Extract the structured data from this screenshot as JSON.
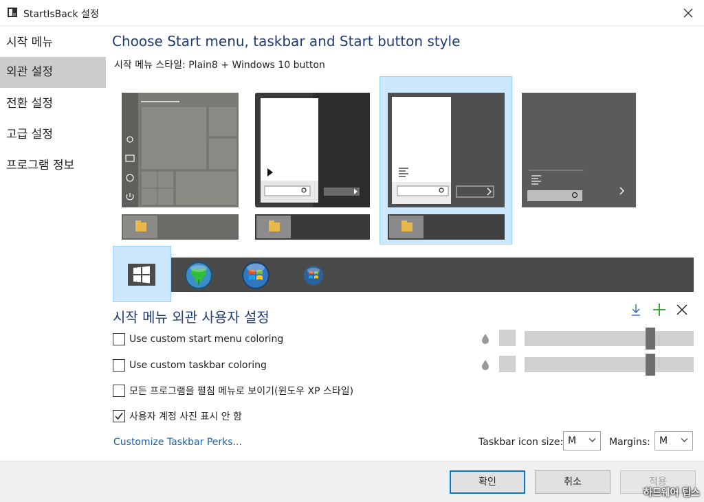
{
  "window": {
    "title": "StartIsBack 설정"
  },
  "sidebar": {
    "items": [
      {
        "label": "시작 메뉴",
        "active": false
      },
      {
        "label": "외관 설정",
        "active": true
      },
      {
        "label": "전환 설정",
        "active": false
      },
      {
        "label": "고급 설정",
        "active": false
      },
      {
        "label": "프로그램 정보",
        "active": false
      }
    ]
  },
  "main": {
    "heading": "Choose Start menu, taskbar and Start button style",
    "style_label": "시작 메뉴 스타일:",
    "style_value": "Plain8 + Windows 10 button"
  },
  "styles": [
    {
      "icon": "windows10-style-preview-icon",
      "selected": false
    },
    {
      "icon": "windows7-style-preview-icon",
      "selected": false
    },
    {
      "icon": "plain8-style-preview-icon",
      "selected": true
    },
    {
      "icon": "windows8-style-preview-icon",
      "selected": false
    }
  ],
  "start_buttons": [
    {
      "icon": "windows10-logo-icon",
      "selected": true
    },
    {
      "icon": "clover-orb-icon",
      "selected": false
    },
    {
      "icon": "windows7-orb-icon",
      "selected": false
    },
    {
      "icon": "windows-orb-small-icon",
      "selected": false
    }
  ],
  "customize": {
    "title": "시작 메뉴 외관 사용자 설정",
    "tools": [
      "download-icon",
      "add-icon",
      "close-icon"
    ],
    "options": [
      {
        "label": "Use custom start menu coloring",
        "checked": false
      },
      {
        "label": "Use custom taskbar coloring",
        "checked": false
      },
      {
        "label": "모든 프로그램을 펼침 메뉴로 보이기(윈도우 XP 스타일)",
        "checked": false
      },
      {
        "label": "사용자 계정 사진 표시 안 함",
        "checked": true
      }
    ],
    "sliders": [
      {
        "level": 0.76
      },
      {
        "level": 0.76
      }
    ],
    "perks_link": "Customize Taskbar Perks...",
    "icon_size_label": "Taskbar icon size:",
    "icon_size_value": "M",
    "margins_label": "Margins:",
    "margins_value": "M"
  },
  "colors": {
    "accent": "#0078d7",
    "heading": "#1f3b73",
    "selection": "#cce8ff"
  },
  "footer": {
    "ok_label": "확인",
    "cancel_label": "취소",
    "apply_label": "적용"
  },
  "watermark": "하드웨어 팁스"
}
